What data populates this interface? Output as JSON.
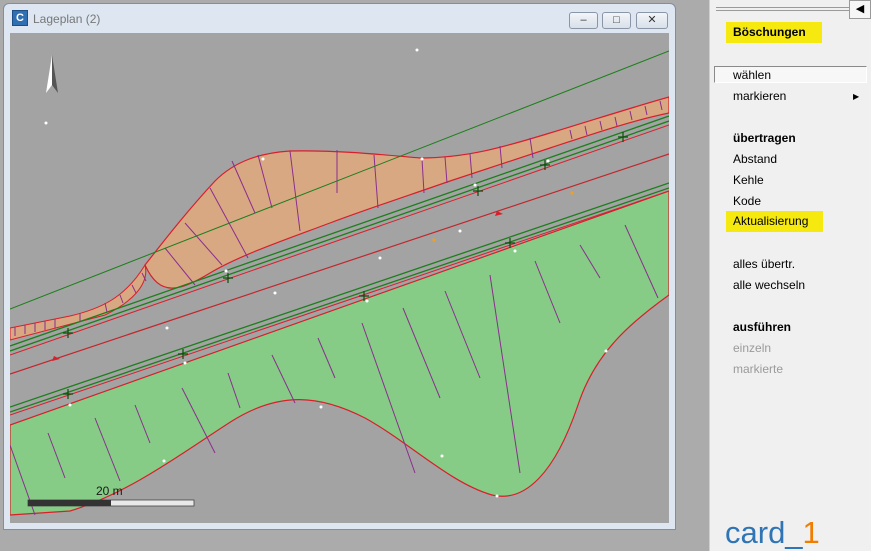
{
  "window": {
    "title": "Lageplan (2)",
    "icon": "app-icon",
    "controls": {
      "minimize": "–",
      "maximize": "□",
      "close": "✕"
    }
  },
  "map": {
    "north_arrow_icon": "north-arrow-icon",
    "scale_label": "20 m",
    "colors": {
      "background": "#a3a3a3",
      "fill_slope": "#d8a883",
      "fill_green": "#86cc86",
      "boundary_red": "#d81f2a",
      "road_green": "#1c7f1c",
      "hatch_purple": "#8a2e8e",
      "centerline_red": "#c1272d"
    }
  },
  "panel": {
    "collapse_icon": "◀",
    "heading": "Böschungen",
    "items": [
      {
        "label": "wählen"
      },
      {
        "label": "markieren"
      },
      {
        "label": "übertragen"
      },
      {
        "label": "Abstand"
      },
      {
        "label": "Kehle"
      },
      {
        "label": "Kode"
      },
      {
        "label": "Aktualisierung"
      },
      {
        "label": "alles übertr."
      },
      {
        "label": "alle wechseln"
      },
      {
        "label": "ausführen"
      },
      {
        "label": "einzeln"
      },
      {
        "label": "markierte"
      }
    ],
    "submenu_arrow": "▶",
    "logo_text": "card_",
    "logo_suffix": "1"
  }
}
